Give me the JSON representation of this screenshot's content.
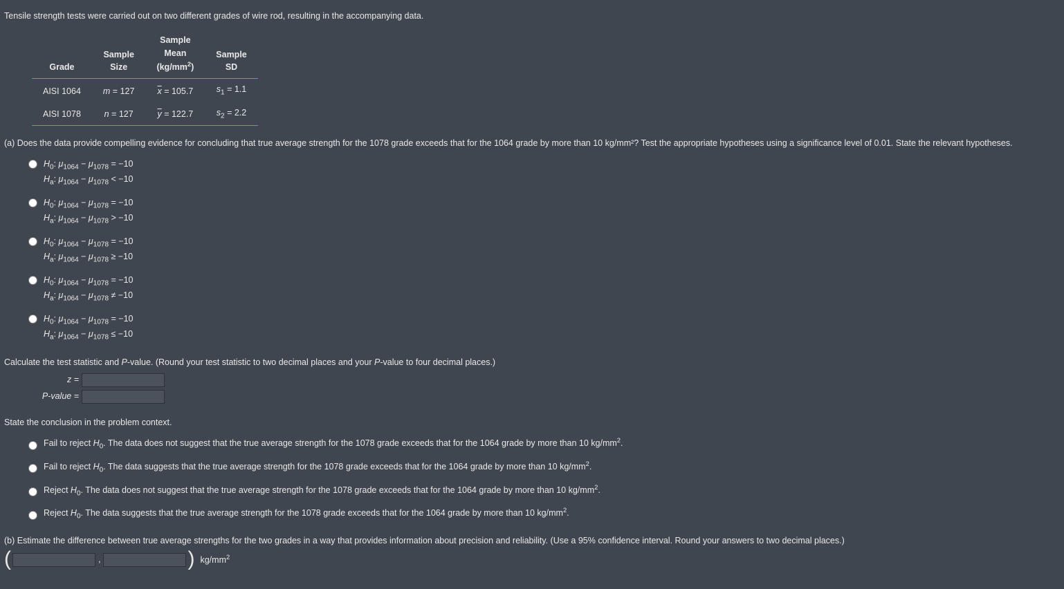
{
  "intro": "Tensile strength tests were carried out on two different grades of wire rod, resulting in the accompanying data.",
  "table": {
    "headers": {
      "grade": "Grade",
      "size": "Sample\nSize",
      "mean": "Sample\nMean\n(kg/mm²)",
      "sd": "Sample\nSD"
    },
    "row1": {
      "grade": "AISI 1064",
      "size_var": "m",
      "size_val": "127",
      "mean_var": "x",
      "mean_val": "105.7",
      "sd_sub": "1",
      "sd_val": "1.1"
    },
    "row2": {
      "grade": "AISI 1078",
      "size_var": "n",
      "size_val": "127",
      "mean_var": "y",
      "mean_val": "122.7",
      "sd_sub": "2",
      "sd_val": "2.2"
    }
  },
  "partA": {
    "prompt": "(a) Does the data provide compelling evidence for concluding that true average strength for the 1078 grade exceeds that for the 1064 grade by more than 10 kg/mm²? Test the appropriate hypotheses using a significance level of 0.01. State the relevant hypotheses.",
    "mu": {
      "sub1": "1064",
      "sub2": "1078"
    },
    "null_rhs": "= −10",
    "alt_ops": {
      "lt": "< −10",
      "gt": "> −10",
      "ge": "≥ −10",
      "ne": "≠ −10",
      "le": "≤ −10"
    }
  },
  "calc": {
    "prompt": "Calculate the test statistic and P-value. (Round your test statistic to two decimal places and your P-value to four decimal places.)",
    "z_label": "z =",
    "p_label": "P-value ="
  },
  "concl": {
    "heading": "State the conclusion in the problem context.",
    "opts": {
      "a": "Fail to reject H₀. The data does not suggest that the true average strength for the 1078 grade exceeds that for the 1064 grade by more than 10 kg/mm².",
      "b": "Fail to reject H₀. The data suggests that the true average strength for the 1078 grade exceeds that for the 1064 grade by more than 10 kg/mm².",
      "c": "Reject H₀. The data does not suggest that the true average strength for the 1078 grade exceeds that for the 1064 grade by more than 10 kg/mm².",
      "d": "Reject H₀. The data suggests that the true average strength for the 1078 grade exceeds that for the 1064 grade by more than 10 kg/mm²."
    }
  },
  "partB": {
    "prompt": "(b) Estimate the difference between true average strengths for the two grades in a way that provides information about precision and reliability. (Use a 95% confidence interval. Round your answers to two decimal places.)",
    "unit": "kg/mm²",
    "comma": ","
  }
}
